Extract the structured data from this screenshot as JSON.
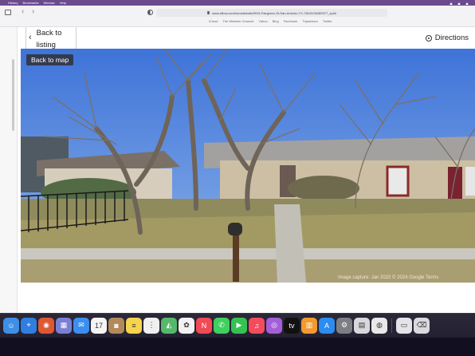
{
  "menubar": {
    "items": [
      "History",
      "Bookmarks",
      "Window",
      "Help"
    ]
  },
  "browser": {
    "url": "www.zillow.com/homedetails/5915-Fairgreen-St-San-Antonio-TX-78242/26389377_zpid/",
    "favorites": [
      "iCloud",
      "The Weather Channel",
      "Yahoo",
      "Bing",
      "Facebook",
      "Tripadvisor",
      "Twitter"
    ],
    "back_glyph": "‹",
    "forward_glyph": "›"
  },
  "page": {
    "back_to_listing": "Back to listing",
    "directions": "Directions",
    "back_to_map": "Back to map",
    "watermark": "Image capture: Jan 2022 © 2024 Google  Terms"
  },
  "dock": {
    "apps": [
      {
        "name": "finder-icon",
        "color": "#3d8fe6",
        "glyph": "☺"
      },
      {
        "name": "safari-icon",
        "color": "#2f7ee0",
        "glyph": "⌖"
      },
      {
        "name": "duckduckgo-icon",
        "color": "#de5833",
        "glyph": "◉"
      },
      {
        "name": "launchpad-icon",
        "color": "#7a7fd6",
        "glyph": "▦"
      },
      {
        "name": "mail-icon",
        "color": "#3b8ff0",
        "glyph": "✉"
      },
      {
        "name": "calendar-icon",
        "color": "#f4f4f4",
        "glyph": "17"
      },
      {
        "name": "contacts-icon",
        "color": "#b3895b",
        "glyph": "◙"
      },
      {
        "name": "notes-icon",
        "color": "#f6d44e",
        "glyph": "≡"
      },
      {
        "name": "reminders-icon",
        "color": "#f0f0f0",
        "glyph": "⋮"
      },
      {
        "name": "maps-icon",
        "color": "#55b96b",
        "glyph": "◭"
      },
      {
        "name": "photos-icon",
        "color": "#f2f2f2",
        "glyph": "✿"
      },
      {
        "name": "news-icon",
        "color": "#f04a55",
        "glyph": "N"
      },
      {
        "name": "messages-icon",
        "color": "#3fd05e",
        "glyph": "✆"
      },
      {
        "name": "facetime-icon",
        "color": "#35c253",
        "glyph": "▶"
      },
      {
        "name": "music-icon",
        "color": "#f24c5e",
        "glyph": "♫"
      },
      {
        "name": "podcasts-icon",
        "color": "#a45ed9",
        "glyph": "◎"
      },
      {
        "name": "tv-icon",
        "color": "#111111",
        "glyph": "tv"
      },
      {
        "name": "books-icon",
        "color": "#f39a2e",
        "glyph": "▥"
      },
      {
        "name": "app-store-icon",
        "color": "#2c8cf0",
        "glyph": "A"
      },
      {
        "name": "system-settings-icon",
        "color": "#7d7d84",
        "glyph": "⚙"
      },
      {
        "name": "printer-icon",
        "color": "#d8d8dc",
        "glyph": "▤"
      },
      {
        "name": "chrome-icon",
        "color": "#e9e9ea",
        "glyph": "◍"
      },
      {
        "name": "downloads-icon",
        "color": "#e3e3e8",
        "glyph": "▭"
      },
      {
        "name": "trash-icon",
        "color": "#d9d9de",
        "glyph": "⌫"
      }
    ]
  }
}
